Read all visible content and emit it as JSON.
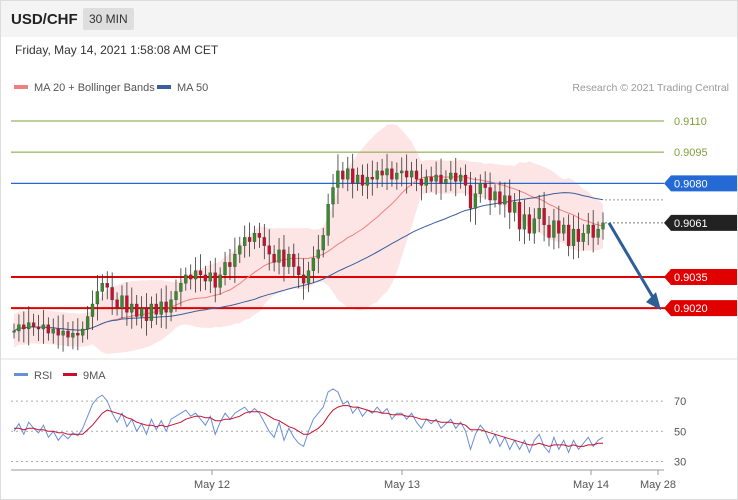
{
  "header": {
    "symbol": "USD/CHF",
    "timeframe": "30 MIN",
    "datetime": "Friday, May 14, 2021 1:58:08 AM CET",
    "copyright": "Research © 2021 Trading Central"
  },
  "legend": {
    "ma20_label": "MA 20 + Bollinger Bands",
    "ma50_label": "MA 50",
    "rsi_label": "RSI",
    "rsi_ma_label": "9MA"
  },
  "colors": {
    "bull": "#3a8a2e",
    "bear": "#c8102e",
    "ma20": "#f08080",
    "band": "#fde0e0",
    "ma50": "#3a5f9a",
    "level_green": "#7ea13a",
    "level_blue": "#2469d4",
    "level_red": "#e00000",
    "last_price": "#222222",
    "arrow": "#2d5e96",
    "rsi": "#6a8fd6",
    "rsi_ma": "#c8102e"
  },
  "chart_data": [
    {
      "type": "candlestick",
      "x_labels": [
        "May 12",
        "May 13",
        "May 14",
        "May 28"
      ],
      "ylim": [
        0.8997,
        0.9122
      ],
      "y_levels": [
        {
          "label": "0.9110",
          "value": 0.911,
          "kind": "resistance"
        },
        {
          "label": "0.9095",
          "value": 0.9095,
          "kind": "resistance"
        },
        {
          "label": "0.9080",
          "value": 0.908,
          "kind": "pivot"
        },
        {
          "label": "0.9061",
          "value": 0.9061,
          "kind": "last"
        },
        {
          "label": "0.9035",
          "value": 0.9035,
          "kind": "support"
        },
        {
          "label": "0.9020",
          "value": 0.902,
          "kind": "support"
        }
      ],
      "close_start": 0.9009,
      "close_path": [
        0.9009,
        0.9012,
        0.901,
        0.9013,
        0.9011,
        0.901,
        0.9012,
        0.9008,
        0.901,
        0.9007,
        0.9009,
        0.9006,
        0.9008,
        0.9007,
        0.901,
        0.9016,
        0.9022,
        0.9028,
        0.9032,
        0.903,
        0.9024,
        0.902,
        0.9026,
        0.9018,
        0.9022,
        0.9016,
        0.902,
        0.9014,
        0.9022,
        0.9017,
        0.9023,
        0.9018,
        0.9024,
        0.9028,
        0.9032,
        0.9036,
        0.9034,
        0.9038,
        0.9036,
        0.9033,
        0.9037,
        0.903,
        0.9036,
        0.9042,
        0.904,
        0.9046,
        0.905,
        0.9054,
        0.9052,
        0.9056,
        0.9054,
        0.905,
        0.9046,
        0.9042,
        0.9048,
        0.904,
        0.9046,
        0.904,
        0.9036,
        0.9032,
        0.9038,
        0.9044,
        0.9048,
        0.9055,
        0.907,
        0.9078,
        0.9086,
        0.9082,
        0.9087,
        0.908,
        0.9084,
        0.9079,
        0.9083,
        0.9082,
        0.9086,
        0.9084,
        0.9087,
        0.9082,
        0.9085,
        0.9086,
        0.9083,
        0.9086,
        0.9082,
        0.9079,
        0.9083,
        0.9081,
        0.9084,
        0.908,
        0.9082,
        0.9085,
        0.9081,
        0.9084,
        0.9079,
        0.9068,
        0.9075,
        0.908,
        0.9078,
        0.9072,
        0.9076,
        0.907,
        0.9074,
        0.9066,
        0.9071,
        0.9058,
        0.9065,
        0.9056,
        0.9063,
        0.9068,
        0.906,
        0.9054,
        0.9062,
        0.9056,
        0.906,
        0.905,
        0.9058,
        0.9052,
        0.9056,
        0.906,
        0.9054,
        0.9058,
        0.9061
      ],
      "forecast_target": 0.902
    },
    {
      "type": "line",
      "title": "RSI",
      "ylim": [
        25,
        80
      ],
      "y_ticks": [
        70,
        50,
        30
      ],
      "series": [
        {
          "name": "RSI",
          "values": [
            50,
            55,
            48,
            56,
            52,
            49,
            54,
            46,
            50,
            44,
            48,
            45,
            49,
            47,
            52,
            60,
            68,
            72,
            74,
            70,
            62,
            56,
            62,
            53,
            58,
            50,
            55,
            48,
            58,
            51,
            57,
            50,
            58,
            60,
            62,
            64,
            60,
            62,
            58,
            54,
            60,
            48,
            56,
            62,
            58,
            62,
            64,
            66,
            62,
            65,
            62,
            56,
            50,
            46,
            56,
            44,
            52,
            46,
            42,
            40,
            50,
            58,
            62,
            66,
            76,
            78,
            76,
            68,
            70,
            62,
            66,
            60,
            64,
            62,
            66,
            62,
            65,
            58,
            62,
            62,
            58,
            62,
            56,
            52,
            58,
            55,
            58,
            52,
            55,
            58,
            52,
            56,
            50,
            38,
            48,
            54,
            50,
            42,
            48,
            40,
            46,
            38,
            44,
            38,
            44,
            36,
            44,
            48,
            40,
            36,
            46,
            38,
            44,
            36,
            44,
            38,
            42,
            46,
            40,
            44,
            46
          ]
        },
        {
          "name": "9MA",
          "values": [
            52,
            52,
            51,
            52,
            52,
            51,
            51,
            50,
            50,
            49,
            49,
            48,
            48,
            48,
            48,
            51,
            54,
            58,
            62,
            64,
            63,
            62,
            61,
            59,
            58,
            56,
            55,
            54,
            54,
            53,
            54,
            53,
            54,
            55,
            56,
            58,
            59,
            60,
            60,
            59,
            59,
            57,
            57,
            58,
            58,
            59,
            60,
            62,
            63,
            63,
            63,
            62,
            60,
            58,
            57,
            55,
            53,
            52,
            50,
            48,
            48,
            50,
            52,
            55,
            60,
            64,
            66,
            67,
            67,
            66,
            66,
            65,
            64,
            63,
            63,
            62,
            62,
            61,
            61,
            61,
            60,
            60,
            59,
            58,
            58,
            57,
            57,
            56,
            56,
            56,
            55,
            55,
            54,
            51,
            51,
            51,
            50,
            49,
            48,
            47,
            46,
            45,
            44,
            43,
            42,
            41,
            41,
            42,
            41,
            40,
            41,
            41,
            41,
            40,
            41,
            40,
            40,
            41,
            41,
            42,
            42
          ]
        }
      ]
    }
  ]
}
